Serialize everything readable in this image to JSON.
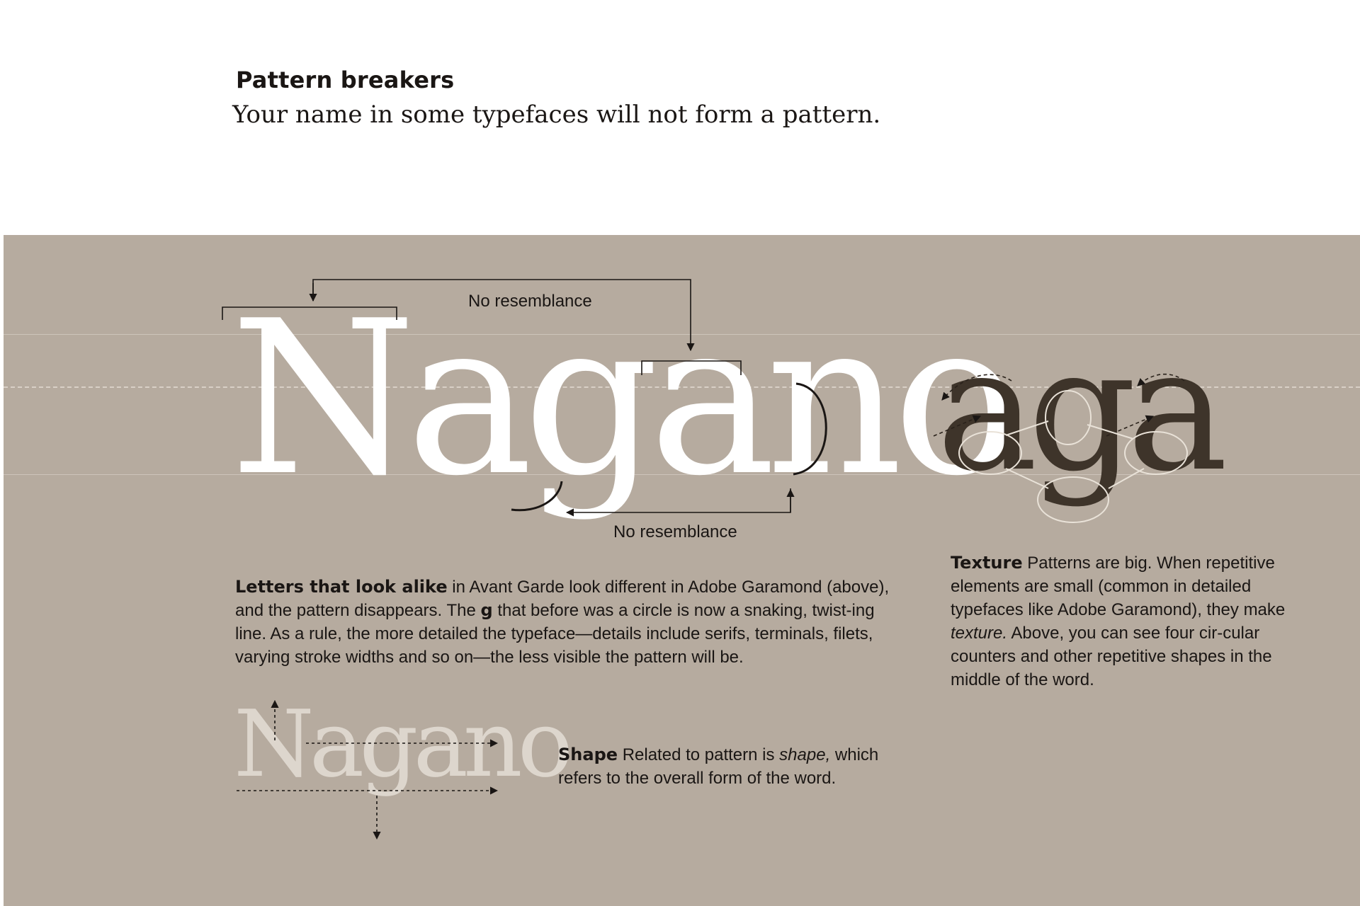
{
  "header": {
    "title": "Pattern breakers",
    "subtitle": "Your name in some typefaces will not form a pattern."
  },
  "illustration": {
    "main_word": "Nagano",
    "texture_word": "aga",
    "shape_word": "Nagano",
    "label_top": "No resemblance",
    "label_bottom": "No resemblance"
  },
  "captions": {
    "letters": {
      "lead": "Letters that look alike",
      "text1": " in Avant Garde look different in Adobe Garamond (above), and the pattern disappears. The ",
      "letter_g": "g",
      "text2": " that before was a circle is now a snaking, twist-ing line. As a rule, the more detailed the typeface—details include serifs, terminals, filets, varying stroke widths and so on—the less visible the pattern will be."
    },
    "texture": {
      "lead": "Texture",
      "text1": " Patterns are big. When repetitive elements are small (common in detailed typefaces like Adobe Garamond), they make ",
      "em": "texture.",
      "text2": " Above, you can see four cir-cular counters and other repetitive shapes in the middle of the word."
    },
    "shape": {
      "lead": "Shape",
      "text1": " Related to pattern is ",
      "em": "shape,",
      "text2": " which refers to the overall form of the word."
    }
  },
  "colors": {
    "panel_background": "#b6ab9f",
    "main_word": "#ffffff",
    "texture_word": "#3e342a",
    "shape_word": "#ddd6cd",
    "text": "#1a1614"
  }
}
